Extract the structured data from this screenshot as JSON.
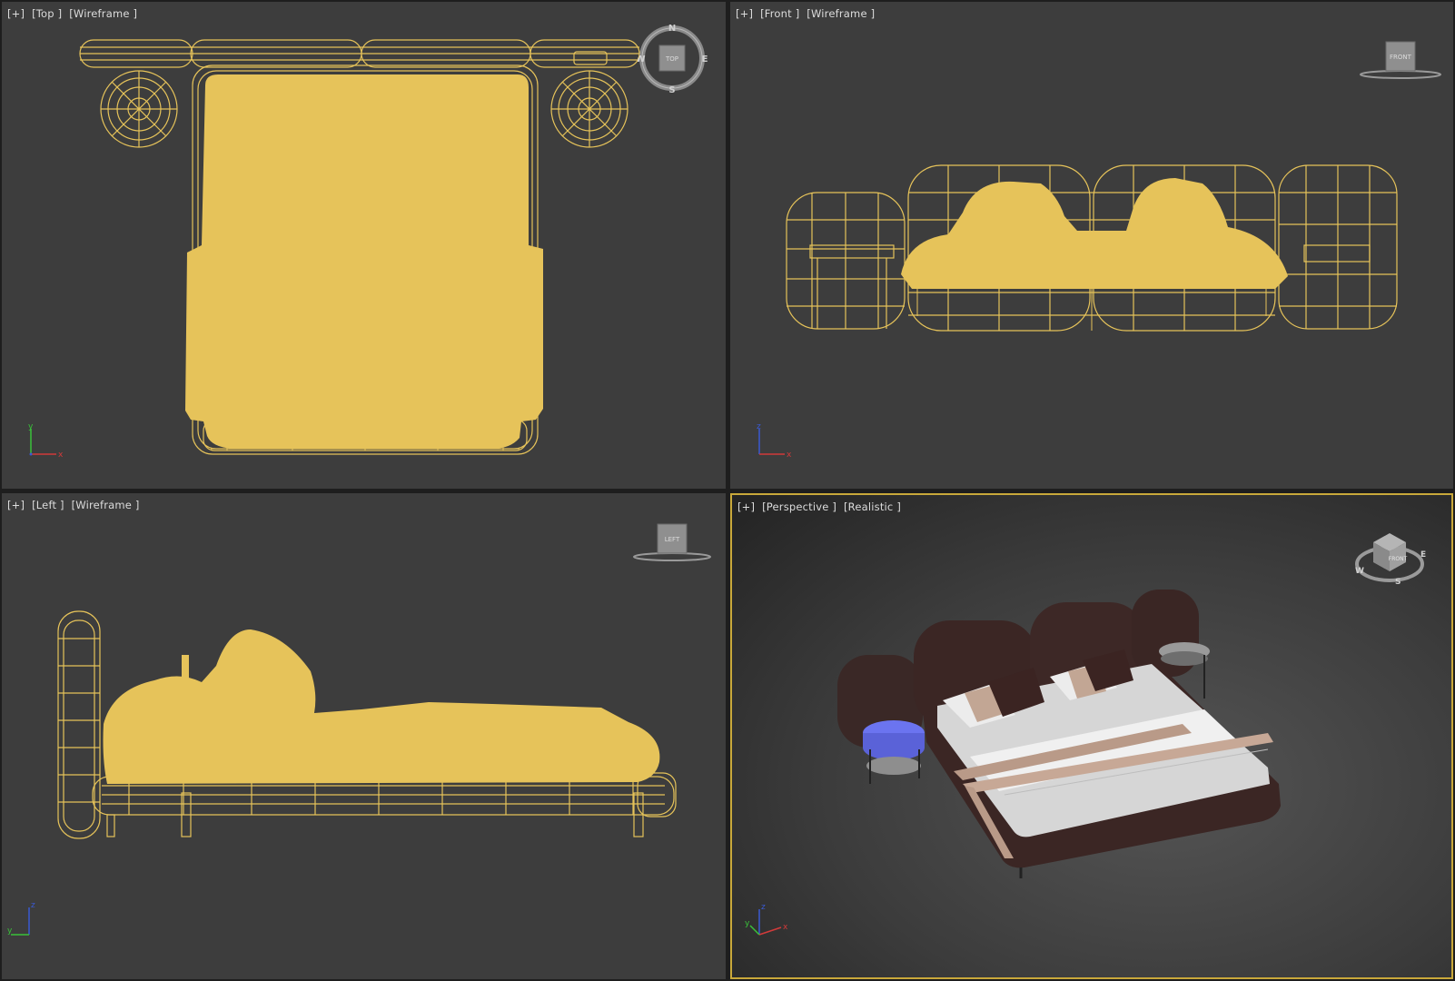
{
  "viewports": [
    {
      "id": "top",
      "labels": [
        "[+]",
        "[Top ]",
        "[Wireframe ]"
      ],
      "navcube": {
        "face": "TOP",
        "compass": {
          "n": "N",
          "e": "E",
          "s": "S",
          "w": "W"
        }
      },
      "axes": {
        "v": "y",
        "h": "x"
      }
    },
    {
      "id": "front",
      "labels": [
        "[+]",
        "[Front ]",
        "[Wireframe ]"
      ],
      "navcube": {
        "face": "FRONT"
      },
      "axes": {
        "v": "z",
        "h": "x"
      }
    },
    {
      "id": "left",
      "labels": [
        "[+]",
        "[Left ]",
        "[Wireframe ]"
      ],
      "navcube": {
        "face": "LEFT"
      },
      "axes": {
        "v": "z",
        "h": "y"
      }
    },
    {
      "id": "perspective",
      "labels": [
        "[+]",
        "[Perspective ]",
        "[Realistic ]"
      ],
      "navcube": {
        "face": "FRONT",
        "compass": {
          "w": "W",
          "s": "S",
          "e": "E"
        }
      },
      "axes": {
        "v": "z",
        "h": "x",
        "d": "y"
      }
    }
  ],
  "colors": {
    "wireframe": "#e6c35a",
    "viewport_bg": "#3d3d3d",
    "active_border": "#c9a83a",
    "axis_x": "#d23a3a",
    "axis_y": "#3ac23a",
    "axis_z": "#3a5ad2",
    "bed_frame": "#3b2624",
    "bed_sheet": "#d8d8d8",
    "nightstand_selected": "#6b74f0"
  },
  "icons": {
    "navcube": "view-cube-icon",
    "axis_tripod": "axis-gizmo-icon"
  }
}
